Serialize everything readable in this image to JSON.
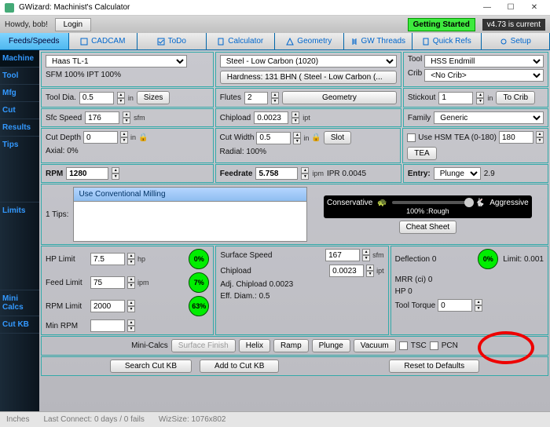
{
  "window": {
    "title": "GWizard: Machinist's Calculator"
  },
  "greet": {
    "hello": "Howdy, bob!",
    "login": "Login",
    "getting_started": "Getting Started",
    "version": "v4.73 is current"
  },
  "tabs": [
    "Feeds/Speeds",
    "CADCAM",
    "ToDo",
    "Calculator",
    "Geometry",
    "GW Threads",
    "Quick Refs",
    "Setup"
  ],
  "side": [
    "Machine",
    "Tool",
    "Mfg",
    "Cut",
    "Results",
    "Tips",
    "Limits",
    "Mini Calcs",
    "Cut KB"
  ],
  "machine": {
    "sel": "Haas TL-1",
    "note": "SFM 100% IPT 100%",
    "mat": "Steel - Low Carbon (1020)",
    "hard": "Hardness: 131 BHN ( Steel - Low Carbon (...",
    "tool_l": "Tool",
    "tool": "HSS Endmill",
    "crib_l": "Crib",
    "crib": "<No Crib>"
  },
  "tool": {
    "dia_l": "Tool Dia.",
    "dia": "0.5",
    "in": "in",
    "sizes": "Sizes",
    "fl_l": "Flutes",
    "fl": "2",
    "geom": "Geometry",
    "so_l": "Stickout",
    "so": "1",
    "tocrib": "To Crib"
  },
  "mfg": {
    "ss_l": "Sfc Speed",
    "ss": "176",
    "sfm": "sfm",
    "cl_l": "Chipload",
    "cl": "0.0023",
    "ipt": "ipt",
    "fam_l": "Family",
    "fam": "Generic"
  },
  "cut": {
    "cd_l": "Cut Depth",
    "cd": "0",
    "ax": "Axial: 0%",
    "cw_l": "Cut Width",
    "cw": "0.5",
    "rad": "Radial: 100%",
    "slot": "Slot",
    "hsm": "Use HSM",
    "tea_l": "TEA (0-180)",
    "tea": "180",
    "teab": "TEA"
  },
  "res": {
    "rpm_l": "RPM",
    "rpm": "1280",
    "fr_l": "Feedrate",
    "fr": "5.758",
    "ipm": "ipm",
    "ipr": "IPR 0.0045",
    "en_l": "Entry:",
    "en": "Plunge",
    "en_v": "2.9"
  },
  "tips": {
    "n": "1 Tips:",
    "msg": "Use Conventional Milling",
    "cons": "Conservative",
    "agg": "Aggressive",
    "rough": "100% :Rough",
    "cs": "Cheat Sheet"
  },
  "lim": {
    "hp_l": "HP Limit",
    "hp": "7.5",
    "hp_u": "hp",
    "hp_p": "0%",
    "fl_l": "Feed Limit",
    "fl": "75",
    "fl_u": "ipm",
    "fl_p": "7%",
    "rl_l": "RPM Limit",
    "rl": "2000",
    "rl_p": "63%",
    "min_l": "Min RPM",
    "min": "",
    "ss_l": "Surface Speed",
    "ss": "167",
    "cl_l": "Chipload",
    "cl": "0.0023",
    "acl": "Adj. Chipload 0.0023",
    "ed": "Eff. Diam.: 0.5",
    "def": "Deflection 0",
    "def_p": "0%",
    "lim": "Limit: 0.001",
    "mrr": "MRR (ci) 0",
    "hpv": "HP 0",
    "tt_l": "Tool Torque",
    "tt": "0"
  },
  "mini": {
    "lbl": "Mini-Calcs",
    "sf": "Surface Finish",
    "he": "Helix",
    "ra": "Ramp",
    "pl": "Plunge",
    "va": "Vacuum",
    "tsc": "TSC",
    "pcn": "PCN"
  },
  "kb": {
    "s": "Search Cut KB",
    "a": "Add to Cut KB",
    "r": "Reset to Defaults"
  },
  "status": {
    "u": "Inches",
    "lc": "Last Connect: 0 days / 0 fails",
    "ws": "WizSize: 1076x802"
  }
}
